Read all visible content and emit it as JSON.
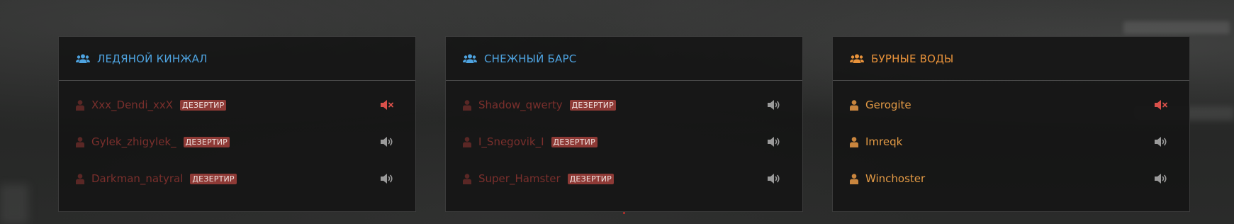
{
  "badge_label": "ДЕЗЕРТИР",
  "colors": {
    "team_blue": "#4ea3e0",
    "team_orange": "#e8923a",
    "deserter_name": "#7a2f2c",
    "badge_bg": "#8e3a36",
    "muted_icon": "#d9504a",
    "speaker_icon": "#9a9a9a"
  },
  "teams": [
    {
      "name": "ЛЕДЯНОЙ КИНЖАЛ",
      "icon": "users-icon",
      "players": [
        {
          "name": "Xxx_Dendi_xxX",
          "status": "deserter",
          "voice": "muted"
        },
        {
          "name": "Gylek_zhigylek_",
          "status": "deserter",
          "voice": "on"
        },
        {
          "name": "Darkman_natyral",
          "status": "deserter",
          "voice": "on"
        }
      ]
    },
    {
      "name": "СНЕЖНЫЙ БАРС",
      "icon": "users-icon",
      "players": [
        {
          "name": "Shadow_qwerty",
          "status": "deserter",
          "voice": "on"
        },
        {
          "name": "I_Snegovik_I",
          "status": "deserter",
          "voice": "on"
        },
        {
          "name": "Super_Hamster",
          "status": "deserter",
          "voice": "on"
        }
      ]
    },
    {
      "name": "БУРНЫЕ ВОДЫ",
      "icon": "users-icon",
      "players": [
        {
          "name": "Gerogite",
          "status": "active",
          "voice": "muted"
        },
        {
          "name": "Imreqk",
          "status": "active",
          "voice": "on"
        },
        {
          "name": "Winchoster",
          "status": "active",
          "voice": "on"
        }
      ]
    }
  ]
}
